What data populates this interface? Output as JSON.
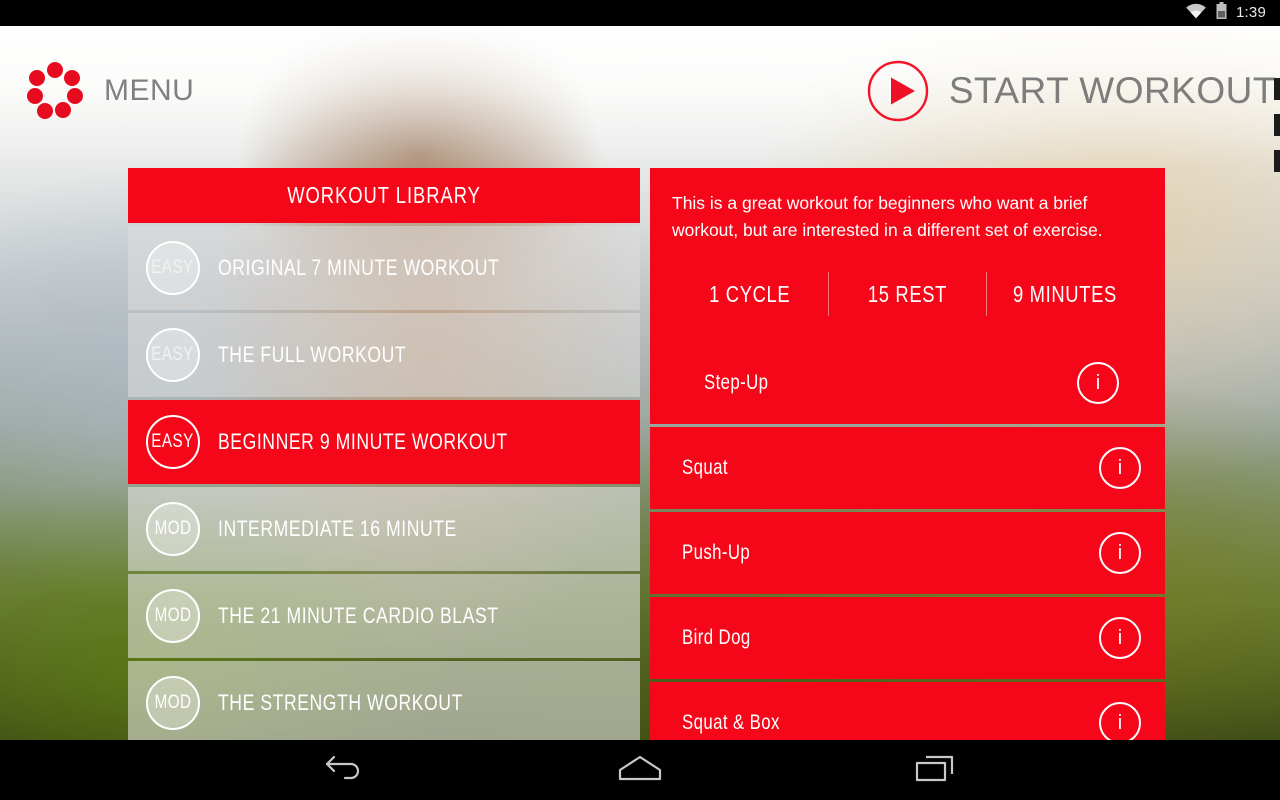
{
  "status_bar": {
    "clock": "1:39",
    "wifi_icon": "wifi-icon",
    "battery_icon": "battery-icon"
  },
  "nav_bar": {
    "back_icon": "back-arrow-icon",
    "home_icon": "home-icon",
    "recents_icon": "recent-apps-icon"
  },
  "app_bar": {
    "menu_label": "MENU",
    "menu_logo_icon": "dot-ring-logo-icon",
    "start_workout_label": "START WORKOUT",
    "play_icon": "play-circle-icon"
  },
  "library": {
    "header": "WORKOUT LIBRARY",
    "items": [
      {
        "level": "EASY",
        "title": "ORIGINAL 7 MINUTE WORKOUT",
        "selected": false
      },
      {
        "level": "EASY",
        "title": "THE FULL WORKOUT",
        "selected": false
      },
      {
        "level": "EASY",
        "title": "BEGINNER 9 MINUTE WORKOUT",
        "selected": true
      },
      {
        "level": "MOD",
        "title": "INTERMEDIATE 16 MINUTE",
        "selected": false
      },
      {
        "level": "MOD",
        "title": "THE 21 MINUTE CARDIO BLAST",
        "selected": false
      },
      {
        "level": "MOD",
        "title": "THE STRENGTH WORKOUT",
        "selected": false
      }
    ]
  },
  "detail": {
    "description": "This is a great workout for beginners who want a brief workout, but are interested in a different set of exercise.",
    "stats": [
      {
        "value": "1 CYCLE"
      },
      {
        "value": "15 REST"
      },
      {
        "value": "9 MINUTES"
      }
    ],
    "exercises": [
      {
        "name": "Step-Up",
        "info_icon": "info-icon"
      },
      {
        "name": "Squat",
        "info_icon": "info-icon"
      },
      {
        "name": "Push-Up",
        "info_icon": "info-icon"
      },
      {
        "name": "Bird Dog",
        "info_icon": "info-icon"
      },
      {
        "name": "Squat & Box",
        "info_icon": "info-icon"
      }
    ]
  },
  "colors": {
    "brand_red": "#f50719",
    "menu_gray": "#808080",
    "white": "#ffffff"
  }
}
